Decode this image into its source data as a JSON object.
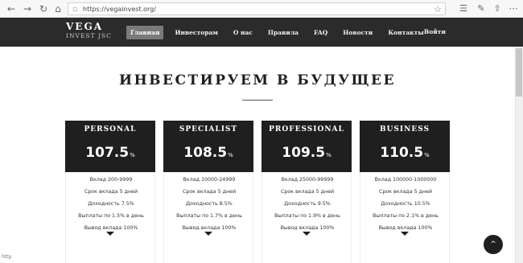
{
  "browser": {
    "url": "https://vegainvest.org/",
    "back_icon": "arrow-left-icon",
    "forward_icon": "arrow-right-icon",
    "refresh_icon": "refresh-icon",
    "home_icon": "home-icon"
  },
  "site": {
    "logo_line1": "VEGA",
    "logo_line2": "INVEST JSC",
    "menu": [
      {
        "label": "Главная",
        "active": true
      },
      {
        "label": "Инвесторам"
      },
      {
        "label": "О нас"
      },
      {
        "label": "Правила"
      },
      {
        "label": "FAQ"
      },
      {
        "label": "Новости"
      },
      {
        "label": "Контакты"
      }
    ],
    "login": "Войти"
  },
  "hero": {
    "headline": "ИНВЕСТИРУЕМ В БУДУЩЕЕ"
  },
  "plans": [
    {
      "name": "PERSONAL",
      "rate": "107.5",
      "unit": "%",
      "details": [
        "Вклад 200-9999",
        "Срок вклада 5 дней",
        "Доходность 7.5%",
        "Выплаты по 1.5% в день",
        "Вывод вклада 100%"
      ]
    },
    {
      "name": "SPECIALIST",
      "rate": "108.5",
      "unit": "%",
      "details": [
        "Вклад 10000-24999",
        "Срок вклада 5 дней",
        "Доходность 8.5%",
        "Выплаты по 1.7% в день",
        "Вывод вклада 100%"
      ]
    },
    {
      "name": "PROFESSIONAL",
      "rate": "109.5",
      "unit": "%",
      "details": [
        "Вклад 25000-99999",
        "Срок вклада 5 дней",
        "Доходность 9.5%",
        "Выплаты по 1.9% в день",
        "Вывод вклада 100%"
      ]
    },
    {
      "name": "BUSINESS",
      "rate": "110.5",
      "unit": "%",
      "details": [
        "Вклад 100000-1000000",
        "Срок вклада 5 дней",
        "Доходность 10.5%",
        "Выплаты по 2.1% в день",
        "Вывод вклада 100%"
      ]
    }
  ],
  "back_to_top_icon": "chevron-up-icon",
  "status_text": "http"
}
